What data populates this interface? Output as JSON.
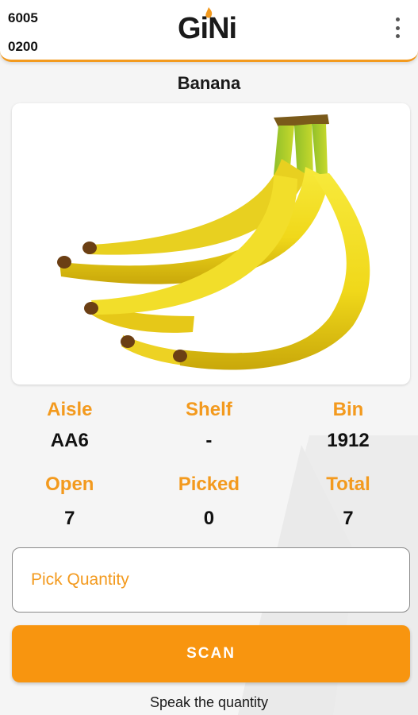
{
  "header": {
    "id_line_1": "6005",
    "id_line_2": "0200",
    "logo_text": "GiNi",
    "menu_icon": "more-vert-icon",
    "accent_color": "#f39a1e"
  },
  "product": {
    "name": "Banana",
    "image_icon": "banana-bunch-image"
  },
  "location": {
    "aisle_label": "Aisle",
    "aisle_value": "AA6",
    "shelf_label": "Shelf",
    "shelf_value": "-",
    "bin_label": "Bin",
    "bin_value": "1912"
  },
  "counts": {
    "open_label": "Open",
    "open_value": "7",
    "picked_label": "Picked",
    "picked_value": "0",
    "total_label": "Total",
    "total_value": "7"
  },
  "pick": {
    "quantity_placeholder": "Pick Quantity",
    "quantity_value": "",
    "scan_label": "SCAN",
    "speak_hint": "Speak the quantity"
  }
}
